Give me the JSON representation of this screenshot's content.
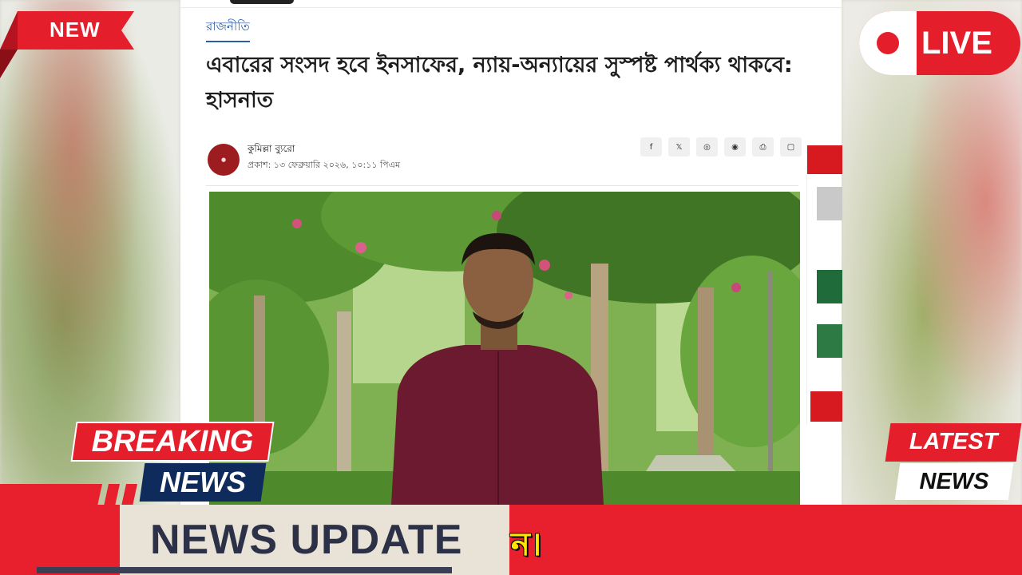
{
  "badges": {
    "new_label": "NEW",
    "live_label": "LIVE"
  },
  "article": {
    "category": "রাজনীতি",
    "headline": "এবারের সংসদ হবে ইনসাফের, ন্যায়-অন্যায়ের সুস্পষ্ট পার্থক্য থাকবে: হাসনাত",
    "author": "কুমিল্লা ব্যুরো",
    "published": "প্রকাশ: ১৩ ফেব্রুয়ারি ২০২৬, ১০:১১ পিএম",
    "share_icons": [
      "facebook-icon",
      "x-icon",
      "whatsapp-icon",
      "messenger-icon",
      "print-icon",
      "copy-icon"
    ],
    "share_glyphs": [
      "f",
      "𝕏",
      "◎",
      "◉",
      "⎙",
      "▢"
    ]
  },
  "overlays": {
    "breaking": "BREAKING",
    "breaking_news": "NEWS",
    "latest": "LATEST",
    "latest_news": "NEWS",
    "news_update": "NEWS UPDATE",
    "ticker_text": "ন।"
  },
  "colors": {
    "accent_red": "#e41e2b",
    "navy": "#0e2b5c",
    "ticker_text": "#ffe600",
    "update_box": "#e8e3d6"
  }
}
